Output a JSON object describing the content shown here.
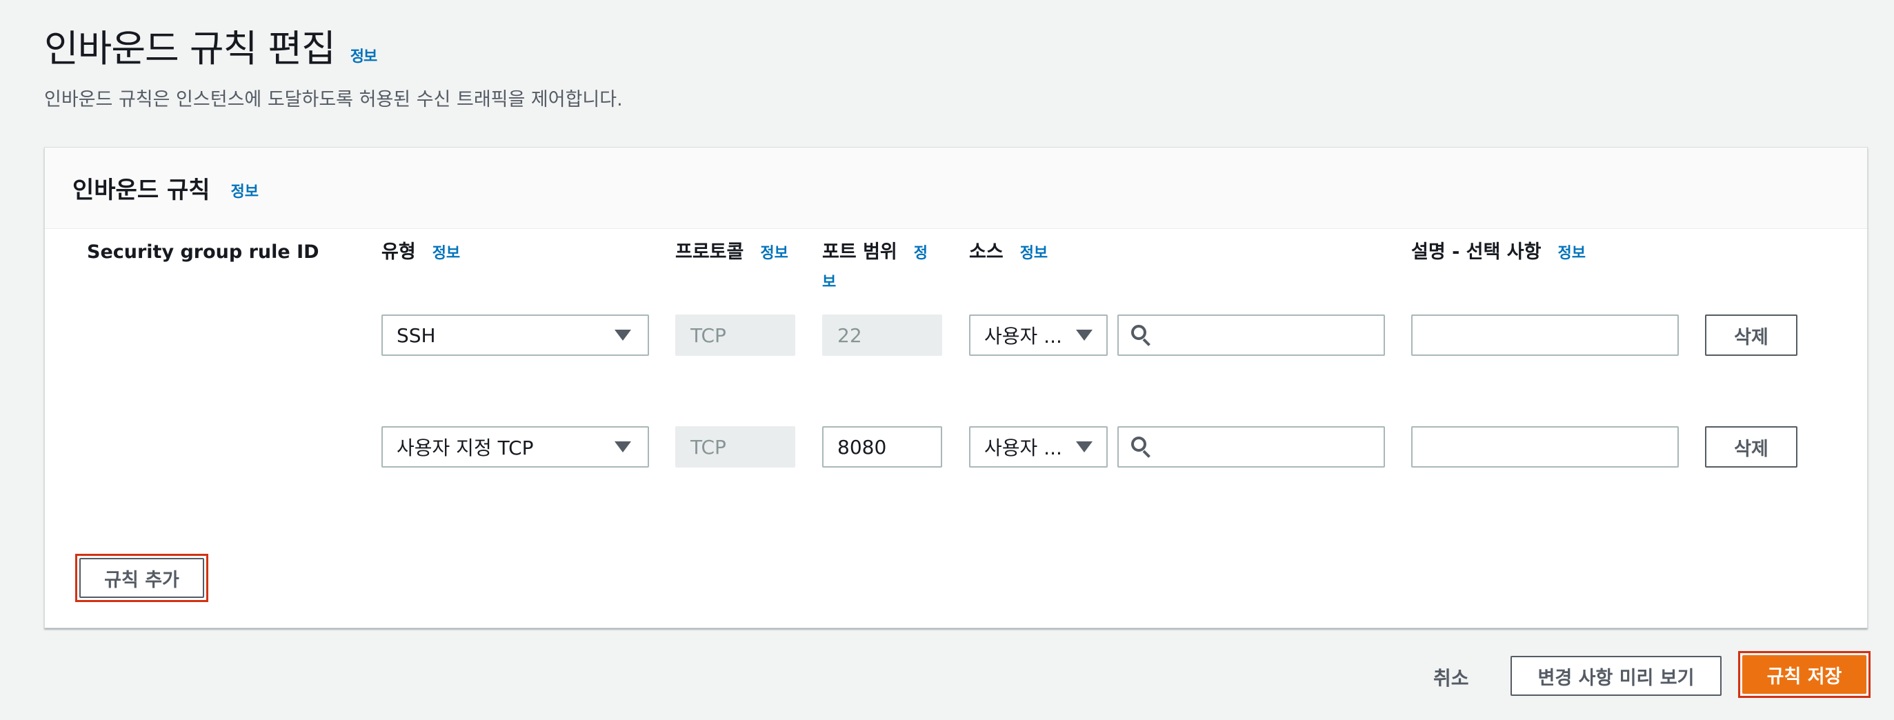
{
  "page": {
    "title": "인바운드 규칙 편집",
    "info": "정보",
    "description": "인바운드 규칙은 인스턴스에 도달하도록 허용된 수신 트래픽을 제어합니다."
  },
  "panel": {
    "title": "인바운드 규칙",
    "info": "정보"
  },
  "columns": {
    "rule_id": "Security group rule ID",
    "type": "유형",
    "protocol": "프로토콜",
    "port_line1": "포트 범위",
    "source": "소스",
    "description": "설명 - 선택 사항",
    "info": "정보",
    "port_info_a": "정",
    "port_info_b": "보"
  },
  "rules": [
    {
      "type": "SSH",
      "protocol": "TCP",
      "port": "22",
      "source": "사용자 ...",
      "search": "",
      "description": "",
      "delete": "삭제"
    },
    {
      "type": "사용자 지정 TCP",
      "protocol": "TCP",
      "port": "8080",
      "source": "사용자 ...",
      "search": "",
      "description": "",
      "delete": "삭제"
    }
  ],
  "add_rule": "규칙 추가",
  "footer": {
    "cancel": "취소",
    "preview": "변경 사항 미리 보기",
    "save": "규칙 저장"
  },
  "colors": {
    "info_link": "#0073bb",
    "primary": "#ec7211",
    "highlight": "#d13212"
  }
}
